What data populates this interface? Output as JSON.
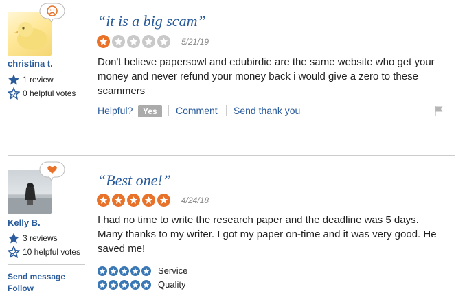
{
  "reviews": [
    {
      "user": {
        "name": "christina t.",
        "reviews_count": "1 review",
        "helpful_votes": "0 helpful votes"
      },
      "mood": "sad-face-icon",
      "title": "“it is a big scam”",
      "rating": 1,
      "date": "5/21/19",
      "text": "Don't believe papersowl and edubirdie are the same website who get your money and never refund your money back i would give a zero to these scammers",
      "actions": {
        "helpful": "Helpful?",
        "yes": "Yes",
        "comment": "Comment",
        "thank": "Send thank you"
      }
    },
    {
      "user": {
        "name": "Kelly B.",
        "reviews_count": "3 reviews",
        "helpful_votes": "10 helpful votes",
        "send_message": "Send message",
        "follow": "Follow"
      },
      "mood": "heart-icon",
      "title": "“Best one!”",
      "rating": 5,
      "date": "4/24/18",
      "text": "I had no time to write the research paper and the deadline was 5 days. Many thanks to my writer. I got my paper on-time and it was very good. He saved me!",
      "subratings": [
        {
          "label": "Service",
          "rating": 5
        },
        {
          "label": "Quality",
          "rating": 5
        }
      ]
    }
  ],
  "colors": {
    "accent_orange": "#e8722a",
    "link_blue": "#2a5b9b",
    "subrating_blue": "#3a77b5"
  }
}
